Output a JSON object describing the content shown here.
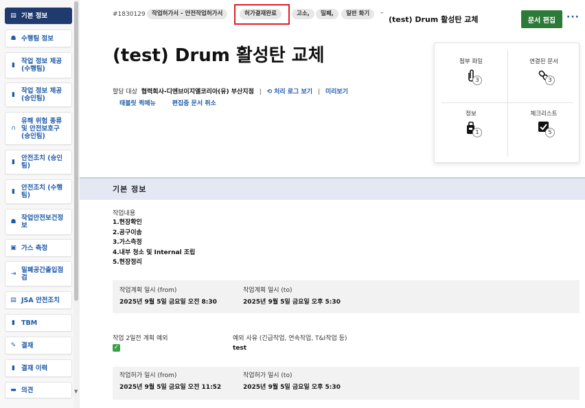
{
  "sidebar": {
    "items": [
      {
        "label": "기본 정보",
        "icon": "clipboard-icon",
        "glyph": "▤"
      },
      {
        "label": "수행팀 정보",
        "icon": "worker-icon",
        "glyph": "☗"
      },
      {
        "label": "작업 정보 제공 (수행팀)",
        "icon": "document-icon",
        "glyph": "▮"
      },
      {
        "label": "작업 정보 제공 (승인팀)",
        "icon": "document-icon",
        "glyph": "▮"
      },
      {
        "label": "유해 위험 종류 및 안전보호구 (승인팀)",
        "icon": "headphones-icon",
        "glyph": "∩"
      },
      {
        "label": "안전조치 (승인팀)",
        "icon": "document-icon",
        "glyph": "▮"
      },
      {
        "label": "안전조치 (수행팀)",
        "icon": "document-icon",
        "glyph": "▮"
      },
      {
        "label": "작업안전보건정보",
        "icon": "worker-icon",
        "glyph": "☗"
      },
      {
        "label": "가스 측정",
        "icon": "gas-can-icon",
        "glyph": "▣"
      },
      {
        "label": "밀폐공간출입점검",
        "icon": "enter-icon",
        "glyph": "⇥"
      },
      {
        "label": "JSA 안전조치",
        "icon": "clipboard-icon",
        "glyph": "▤"
      },
      {
        "label": "TBM",
        "icon": "document-icon",
        "glyph": "▮"
      },
      {
        "label": "결재",
        "icon": "pen-icon",
        "glyph": "✎"
      },
      {
        "label": "결재 이력",
        "icon": "document-icon",
        "glyph": "▮"
      },
      {
        "label": "의견",
        "icon": "comment-icon",
        "glyph": "▬"
      }
    ]
  },
  "header": {
    "doc_id": "#1830129",
    "tags": [
      "작업허가서 - 안전작업허가서",
      "허가결재완료",
      "고소,",
      "밀폐,",
      "일반 화기"
    ],
    "dash": "–",
    "small_title": "(test) Drum 활성탄 교체",
    "edit_button": "문서 편집",
    "more": "···",
    "title": "(test) Drum 활성탄 교체"
  },
  "assignee": {
    "label": "할당 대상",
    "value": "협력회사-디엔브이지엘코리아(유) 부산지점",
    "log_link": "처리 로그 보기",
    "preview_link": "미리보기",
    "tablet_menu": "태블릿 퀵메뉴",
    "cancel_edit": "편집중 문서 취소"
  },
  "attachments": {
    "files": {
      "label": "첨부 파일",
      "count": "3",
      "icon": "paperclip-icon"
    },
    "linked": {
      "label": "연결된 문서",
      "count": "3",
      "icon": "link-icon"
    },
    "info": {
      "label": "정보",
      "count": "1",
      "icon": "info-bag-icon"
    },
    "checklist": {
      "label": "체크리스트",
      "count": "5",
      "icon": "checkbox-icon"
    }
  },
  "section": {
    "title": "기본 정보",
    "work_content_label": "작업내용",
    "work_content": [
      "1.현장확인",
      "2.공구이송",
      "3.가스측정",
      "4.내부 청소 및 Internal 조립",
      "5.현장정리"
    ],
    "plan_from_label": "작업계획 일시 (from)",
    "plan_from": "2025년 9월 5일 금요일 오전 8:30",
    "plan_to_label": "작업계획 일시 (to)",
    "plan_to": "2025년 9월 5일 금요일 오후 5:30",
    "plan2_label": "작업 2일전 계획 예외",
    "plan2_checked": true,
    "exception_label": "예외 사유 (긴급작업, 연속작업, T&I작업 등)",
    "exception_value": "test",
    "permit_from_label": "작업허가 일시 (from)",
    "permit_from": "2025년 9월 5일 금요일 오전 11:52",
    "permit_to_label": "작업허가 일시 (to)",
    "permit_to": "2025년 9월 5일 금요일 오후 5:30"
  }
}
